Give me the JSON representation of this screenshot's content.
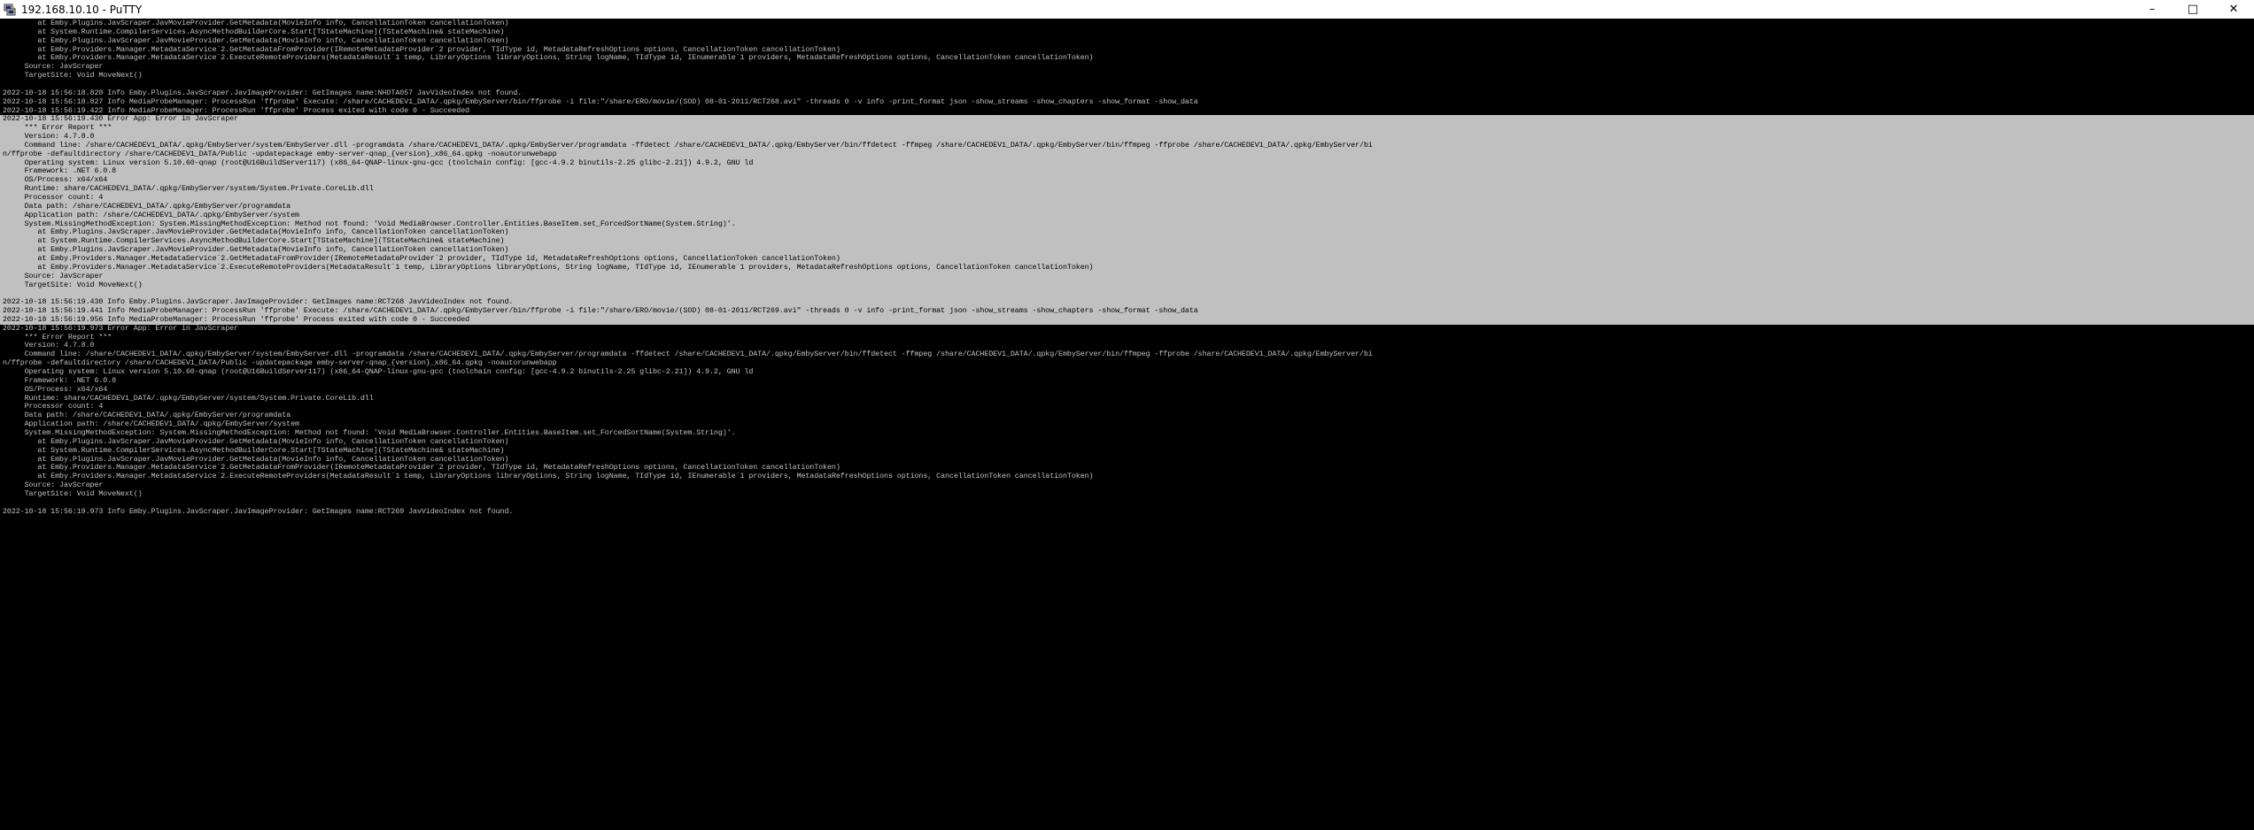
{
  "window": {
    "title": "192.168.10.10 - PuTTY",
    "icon": "putty-icon",
    "controls": {
      "minimize": "–",
      "maximize": "□",
      "close": "✕"
    }
  },
  "terminal": {
    "lines": [
      {
        "text": "        at Emby.Plugins.JavScraper.JavMovieProvider.GetMetadata(MovieInfo info, CancellationToken cancellationToken)",
        "selected": false
      },
      {
        "text": "        at System.Runtime.CompilerServices.AsyncMethodBuilderCore.Start[TStateMachine](TStateMachine& stateMachine)",
        "selected": false
      },
      {
        "text": "        at Emby.Plugins.JavScraper.JavMovieProvider.GetMetadata(MovieInfo info, CancellationToken cancellationToken)",
        "selected": false
      },
      {
        "text": "        at Emby.Providers.Manager.MetadataService`2.GetMetadataFromProvider(IRemoteMetadataProvider`2 provider, TIdType id, MetadataRefreshOptions options, CancellationToken cancellationToken)",
        "selected": false
      },
      {
        "text": "        at Emby.Providers.Manager.MetadataService`2.ExecuteRemoteProviders(MetadataResult`1 temp, LibraryOptions libraryOptions, String logName, TIdType id, IEnumerable`1 providers, MetadataRefreshOptions options, CancellationToken cancellationToken)",
        "selected": false
      },
      {
        "text": "     Source: JavScraper",
        "selected": false
      },
      {
        "text": "     TargetSite: Void MoveNext()",
        "selected": false
      },
      {
        "text": "",
        "selected": false
      },
      {
        "text": "2022-10-18 15:56:18.820 Info Emby.Plugins.JavScraper.JavImageProvider: GetImages name:NHDTA057 JavVideoIndex not found.",
        "selected": false
      },
      {
        "text": "2022-10-18 15:56:18.827 Info MediaProbeManager: ProcessRun 'ffprobe' Execute: /share/CACHEDEV1_DATA/.qpkg/EmbyServer/bin/ffprobe -i file:\"/share/ERO/movie/(SOD) 08-01-2011/RCT268.avi\" -threads 0 -v info -print_format json -show_streams -show_chapters -show_format -show_data",
        "selected": false
      },
      {
        "text": "2022-10-18 15:56:19.422 Info MediaProbeManager: ProcessRun 'ffprobe' Process exited with code 0 - Succeeded",
        "selected": false
      },
      {
        "text": "2022-10-18 15:56:19.430 Error App: Error in JavScraper",
        "selected": true
      },
      {
        "text": "     *** Error Report ***",
        "selected": true
      },
      {
        "text": "     Version: 4.7.8.0",
        "selected": true
      },
      {
        "text": "     Command line: /share/CACHEDEV1_DATA/.qpkg/EmbyServer/system/EmbyServer.dll -programdata /share/CACHEDEV1_DATA/.qpkg/EmbyServer/programdata -ffdetect /share/CACHEDEV1_DATA/.qpkg/EmbyServer/bin/ffdetect -ffmpeg /share/CACHEDEV1_DATA/.qpkg/EmbyServer/bin/ffmpeg -ffprobe /share/CACHEDEV1_DATA/.qpkg/EmbyServer/bi",
        "selected": true
      },
      {
        "text": "n/ffprobe -defaultdirectory /share/CACHEDEV1_DATA/Public -updatepackage emby-server-qnap_{version}_x86_64.qpkg -noautorunwebapp",
        "selected": true
      },
      {
        "text": "     Operating system: Linux version 5.10.60-qnap (root@U16BuildServer117) (x86_64-QNAP-linux-gnu-gcc (toolchain config: [gcc-4.9.2 binutils-2.25 glibc-2.21]) 4.9.2, GNU ld",
        "selected": true
      },
      {
        "text": "     Framework: .NET 6.0.8",
        "selected": true
      },
      {
        "text": "     OS/Process: x64/x64",
        "selected": true
      },
      {
        "text": "     Runtime: share/CACHEDEV1_DATA/.qpkg/EmbyServer/system/System.Private.CoreLib.dll",
        "selected": true
      },
      {
        "text": "     Processor count: 4",
        "selected": true
      },
      {
        "text": "     Data path: /share/CACHEDEV1_DATA/.qpkg/EmbyServer/programdata",
        "selected": true
      },
      {
        "text": "     Application path: /share/CACHEDEV1_DATA/.qpkg/EmbyServer/system",
        "selected": true
      },
      {
        "text": "     System.MissingMethodException: System.MissingMethodException: Method not found: 'Void MediaBrowser.Controller.Entities.BaseItem.set_ForcedSortName(System.String)'.",
        "selected": true
      },
      {
        "text": "        at Emby.Plugins.JavScraper.JavMovieProvider.GetMetadata(MovieInfo info, CancellationToken cancellationToken)",
        "selected": true
      },
      {
        "text": "        at System.Runtime.CompilerServices.AsyncMethodBuilderCore.Start[TStateMachine](TStateMachine& stateMachine)",
        "selected": true
      },
      {
        "text": "        at Emby.Plugins.JavScraper.JavMovieProvider.GetMetadata(MovieInfo info, CancellationToken cancellationToken)",
        "selected": true
      },
      {
        "text": "        at Emby.Providers.Manager.MetadataService`2.GetMetadataFromProvider(IRemoteMetadataProvider`2 provider, TIdType id, MetadataRefreshOptions options, CancellationToken cancellationToken)",
        "selected": true
      },
      {
        "text": "        at Emby.Providers.Manager.MetadataService`2.ExecuteRemoteProviders(MetadataResult`1 temp, LibraryOptions libraryOptions, String logName, TIdType id, IEnumerable`1 providers, MetadataRefreshOptions options, CancellationToken cancellationToken)",
        "selected": true
      },
      {
        "text": "     Source: JavScraper",
        "selected": true
      },
      {
        "text": "     TargetSite: Void MoveNext()",
        "selected": true
      },
      {
        "text": "",
        "selected": true
      },
      {
        "text": "2022-10-18 15:56:19.430 Info Emby.Plugins.JavScraper.JavImageProvider: GetImages name:RCT268 JavVideoIndex not found.",
        "selected": true
      },
      {
        "text": "2022-10-18 15:56:19.441 Info MediaProbeManager: ProcessRun 'ffprobe' Execute: /share/CACHEDEV1_DATA/.qpkg/EmbyServer/bin/ffprobe -i file:\"/share/ERO/movie/(SOD) 08-01-2011/RCT269.avi\" -threads 0 -v info -print_format json -show_streams -show_chapters -show_format -show_data",
        "selected": true
      },
      {
        "text": "2022-10-18 15:56:19.956 Info MediaProbeManager: ProcessRun 'ffprobe' Process exited with code 0 - Succeeded",
        "selected": true
      },
      {
        "text": "2022-10-18 15:56:19.973 Error App: Error in JavScraper",
        "selected": false
      },
      {
        "text": "     *** Error Report ***",
        "selected": false
      },
      {
        "text": "     Version: 4.7.8.0",
        "selected": false
      },
      {
        "text": "     Command line: /share/CACHEDEV1_DATA/.qpkg/EmbyServer/system/EmbyServer.dll -programdata /share/CACHEDEV1_DATA/.qpkg/EmbyServer/programdata -ffdetect /share/CACHEDEV1_DATA/.qpkg/EmbyServer/bin/ffdetect -ffmpeg /share/CACHEDEV1_DATA/.qpkg/EmbyServer/bin/ffmpeg -ffprobe /share/CACHEDEV1_DATA/.qpkg/EmbyServer/bi",
        "selected": false
      },
      {
        "text": "n/ffprobe -defaultdirectory /share/CACHEDEV1_DATA/Public -updatepackage emby-server-qnap_{version}_x86_64.qpkg -noautorunwebapp",
        "selected": false
      },
      {
        "text": "     Operating system: Linux version 5.10.60-qnap (root@U16BuildServer117) (x86_64-QNAP-linux-gnu-gcc (toolchain config: [gcc-4.9.2 binutils-2.25 glibc-2.21]) 4.9.2, GNU ld",
        "selected": false
      },
      {
        "text": "     Framework: .NET 6.0.8",
        "selected": false
      },
      {
        "text": "     OS/Process: x64/x64",
        "selected": false
      },
      {
        "text": "     Runtime: share/CACHEDEV1_DATA/.qpkg/EmbyServer/system/System.Private.CoreLib.dll",
        "selected": false
      },
      {
        "text": "     Processor count: 4",
        "selected": false
      },
      {
        "text": "     Data path: /share/CACHEDEV1_DATA/.qpkg/EmbyServer/programdata",
        "selected": false
      },
      {
        "text": "     Application path: /share/CACHEDEV1_DATA/.qpkg/EmbyServer/system",
        "selected": false
      },
      {
        "text": "     System.MissingMethodException: System.MissingMethodException: Method not found: 'Void MediaBrowser.Controller.Entities.BaseItem.set_ForcedSortName(System.String)'.",
        "selected": false
      },
      {
        "text": "        at Emby.Plugins.JavScraper.JavMovieProvider.GetMetadata(MovieInfo info, CancellationToken cancellationToken)",
        "selected": false
      },
      {
        "text": "        at System.Runtime.CompilerServices.AsyncMethodBuilderCore.Start[TStateMachine](TStateMachine& stateMachine)",
        "selected": false
      },
      {
        "text": "        at Emby.Plugins.JavScraper.JavMovieProvider.GetMetadata(MovieInfo info, CancellationToken cancellationToken)",
        "selected": false
      },
      {
        "text": "        at Emby.Providers.Manager.MetadataService`2.GetMetadataFromProvider(IRemoteMetadataProvider`2 provider, TIdType id, MetadataRefreshOptions options, CancellationToken cancellationToken)",
        "selected": false
      },
      {
        "text": "        at Emby.Providers.Manager.MetadataService`2.ExecuteRemoteProviders(MetadataResult`1 temp, LibraryOptions libraryOptions, String logName, TIdType id, IEnumerable`1 providers, MetadataRefreshOptions options, CancellationToken cancellationToken)",
        "selected": false
      },
      {
        "text": "     Source: JavScraper",
        "selected": false
      },
      {
        "text": "     TargetSite: Void MoveNext()",
        "selected": false
      },
      {
        "text": "",
        "selected": false
      },
      {
        "text": "2022-10-18 15:56:19.973 Info Emby.Plugins.JavScraper.JavImageProvider: GetImages name:RCT269 JavVideoIndex not found.",
        "selected": false
      }
    ]
  },
  "colors": {
    "terminal_bg": "#000000",
    "terminal_fg": "#c0c0c0",
    "selection_bg": "#c0c0c0",
    "selection_fg": "#000000"
  }
}
